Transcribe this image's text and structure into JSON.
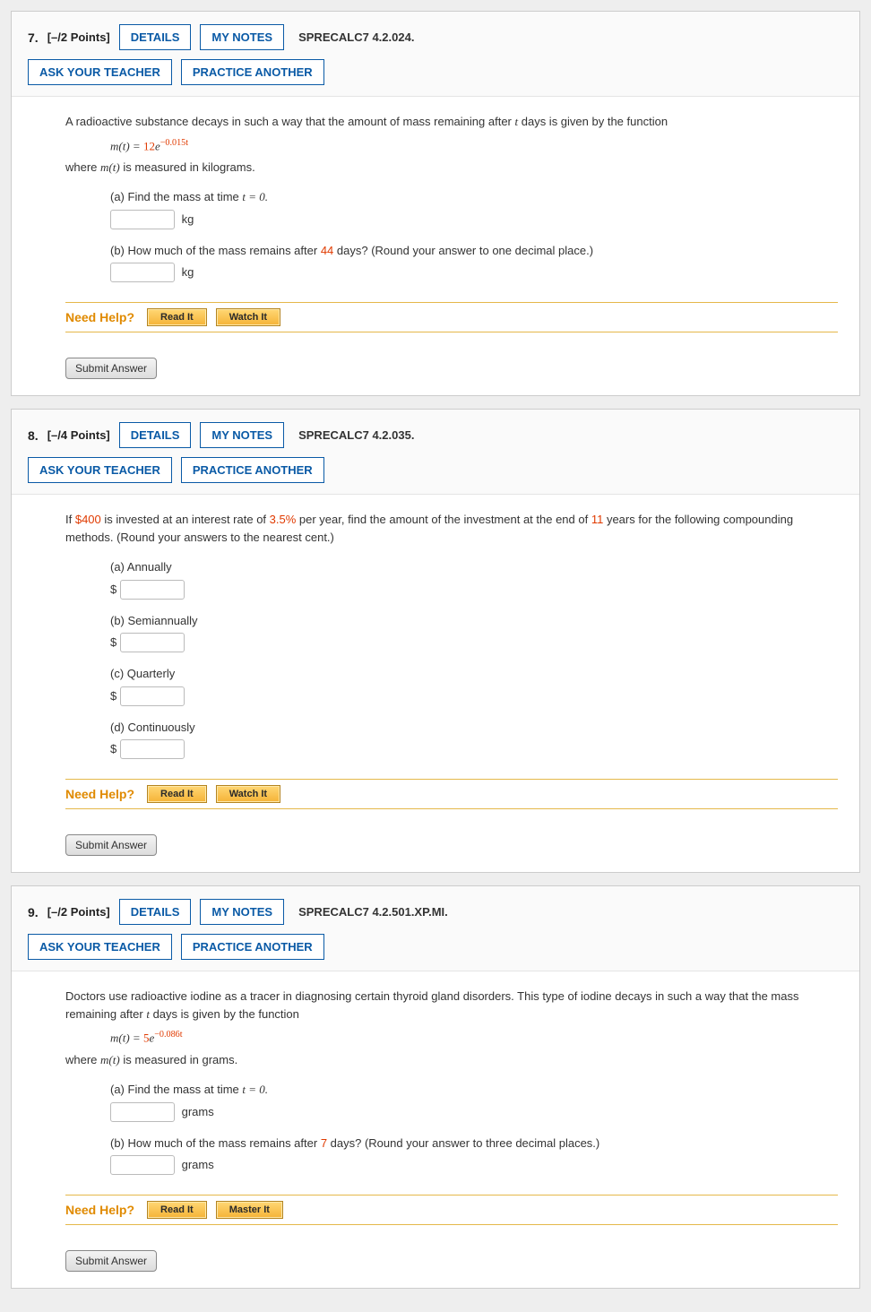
{
  "buttons": {
    "details": "DETAILS",
    "my_notes": "MY NOTES",
    "ask": "ASK YOUR TEACHER",
    "practice": "PRACTICE ANOTHER",
    "submit": "Submit Answer",
    "need_help": "Need Help?",
    "read_it": "Read It",
    "watch_it": "Watch It",
    "master_it": "Master It"
  },
  "q7": {
    "num": "7.",
    "points": "[–/2 Points]",
    "src": "SPRECALC7 4.2.024.",
    "intro_a": "A radioactive substance decays in such a way that the amount of mass remaining after ",
    "intro_b": " days is given by the function",
    "formula_lhs": "m(t) = ",
    "formula_coef": "12",
    "formula_e": "e",
    "formula_exp": "−0.015t",
    "where_a": "where ",
    "where_b": " is measured in kilograms.",
    "mt": "m(t)",
    "t": "t",
    "pa": "(a) Find the mass at time ",
    "pa_eq": "t = 0.",
    "pb_a": "(b) How much of the mass remains after ",
    "pb_days": "44",
    "pb_b": " days? (Round your answer to one decimal place.)",
    "unit": "kg"
  },
  "q8": {
    "num": "8.",
    "points": "[–/4 Points]",
    "src": "SPRECALC7 4.2.035.",
    "intro_a": "If ",
    "amount": "$400",
    "intro_b": " is invested at an interest rate of ",
    "rate": "3.5%",
    "intro_c": " per year, find the amount of the investment at the end of ",
    "years": "11",
    "intro_d": " years for the following compounding methods. (Round your answers to the nearest cent.)",
    "pa": "(a) Annually",
    "pb": "(b) Semiannually",
    "pc": "(c) Quarterly",
    "pd": "(d) Continuously",
    "prefix": "$"
  },
  "q9": {
    "num": "9.",
    "points": "[–/2 Points]",
    "src": "SPRECALC7 4.2.501.XP.MI.",
    "intro_a": "Doctors use radioactive iodine as a tracer in diagnosing certain thyroid gland disorders. This type of iodine decays in such a way that the mass remaining after ",
    "intro_b": " days is given by the function",
    "formula_coef": "5",
    "formula_exp": "−0.086t",
    "where_b": " is measured in grams.",
    "pa": "(a) Find the mass at time ",
    "pa_eq": "t = 0.",
    "pb_a": "(b) How much of the mass remains after ",
    "pb_days": "7",
    "pb_b": " days? (Round your answer to three decimal places.)",
    "unit": "grams"
  }
}
